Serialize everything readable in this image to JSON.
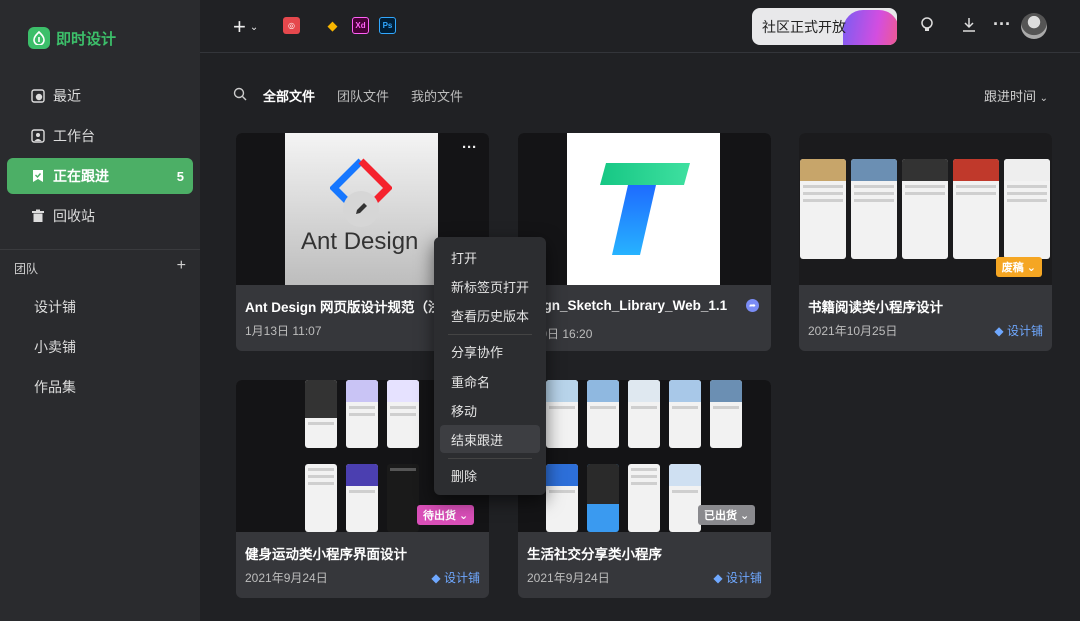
{
  "app": {
    "name": "即时设计",
    "brand_color": "#3cbf6a"
  },
  "sidebar": {
    "items": [
      {
        "label": "最近",
        "icon": "clock-icon"
      },
      {
        "label": "工作台",
        "icon": "workspace-icon"
      },
      {
        "label": "正在跟进",
        "icon": "bookmark-check-icon",
        "count": "5",
        "active": true
      },
      {
        "label": "回收站",
        "icon": "trash-icon"
      }
    ],
    "team_header": "团队",
    "team_add": "+",
    "teams": [
      "设计铺",
      "小卖铺",
      "作品集"
    ]
  },
  "topbar": {
    "plus": "+",
    "app_icons": [
      {
        "name": "figma-like-app-icon",
        "text": "◎",
        "color": "#e5484d"
      },
      {
        "name": "sketch-icon",
        "text": "◆",
        "color": "#f7b500"
      },
      {
        "name": "xd-icon",
        "text": "Xd",
        "color": "#ff61f6"
      },
      {
        "name": "ps-icon",
        "text": "Ps",
        "color": "#31a8ff"
      }
    ],
    "notice": "社区正式开放",
    "more": "···"
  },
  "filter": {
    "tabs": [
      {
        "label": "全部文件",
        "active": true
      },
      {
        "label": "团队文件",
        "active": false
      },
      {
        "label": "我的文件",
        "active": false
      }
    ],
    "sort": "跟进时间"
  },
  "cards": [
    {
      "title": "Ant Design 网页版设计规范（浅",
      "date": "1月13日 11:07",
      "team": "",
      "thumb_text": "Ant Design"
    },
    {
      "title": "Design_Sketch_Library_Web_1.1",
      "date": "1月20日 16:20",
      "team": ""
    },
    {
      "title": "书籍阅读类小程序设计",
      "date": "2021年10月25日",
      "team": "◆ 设计铺",
      "tag": "废稿"
    },
    {
      "title": "健身运动类小程序界面设计",
      "date": "2021年9月24日",
      "team": "◆ 设计铺",
      "tag": "待出货"
    },
    {
      "title": "生活社交分享类小程序",
      "date": "2021年9月24日",
      "team": "◆ 设计铺",
      "tag": "已出货"
    }
  ],
  "context_menu": {
    "items": [
      "打开",
      "新标签页打开",
      "查看历史版本",
      "分享协作",
      "重命名",
      "移动",
      "结束跟进",
      "删除"
    ],
    "hovered": "结束跟进"
  },
  "card_more": "···"
}
